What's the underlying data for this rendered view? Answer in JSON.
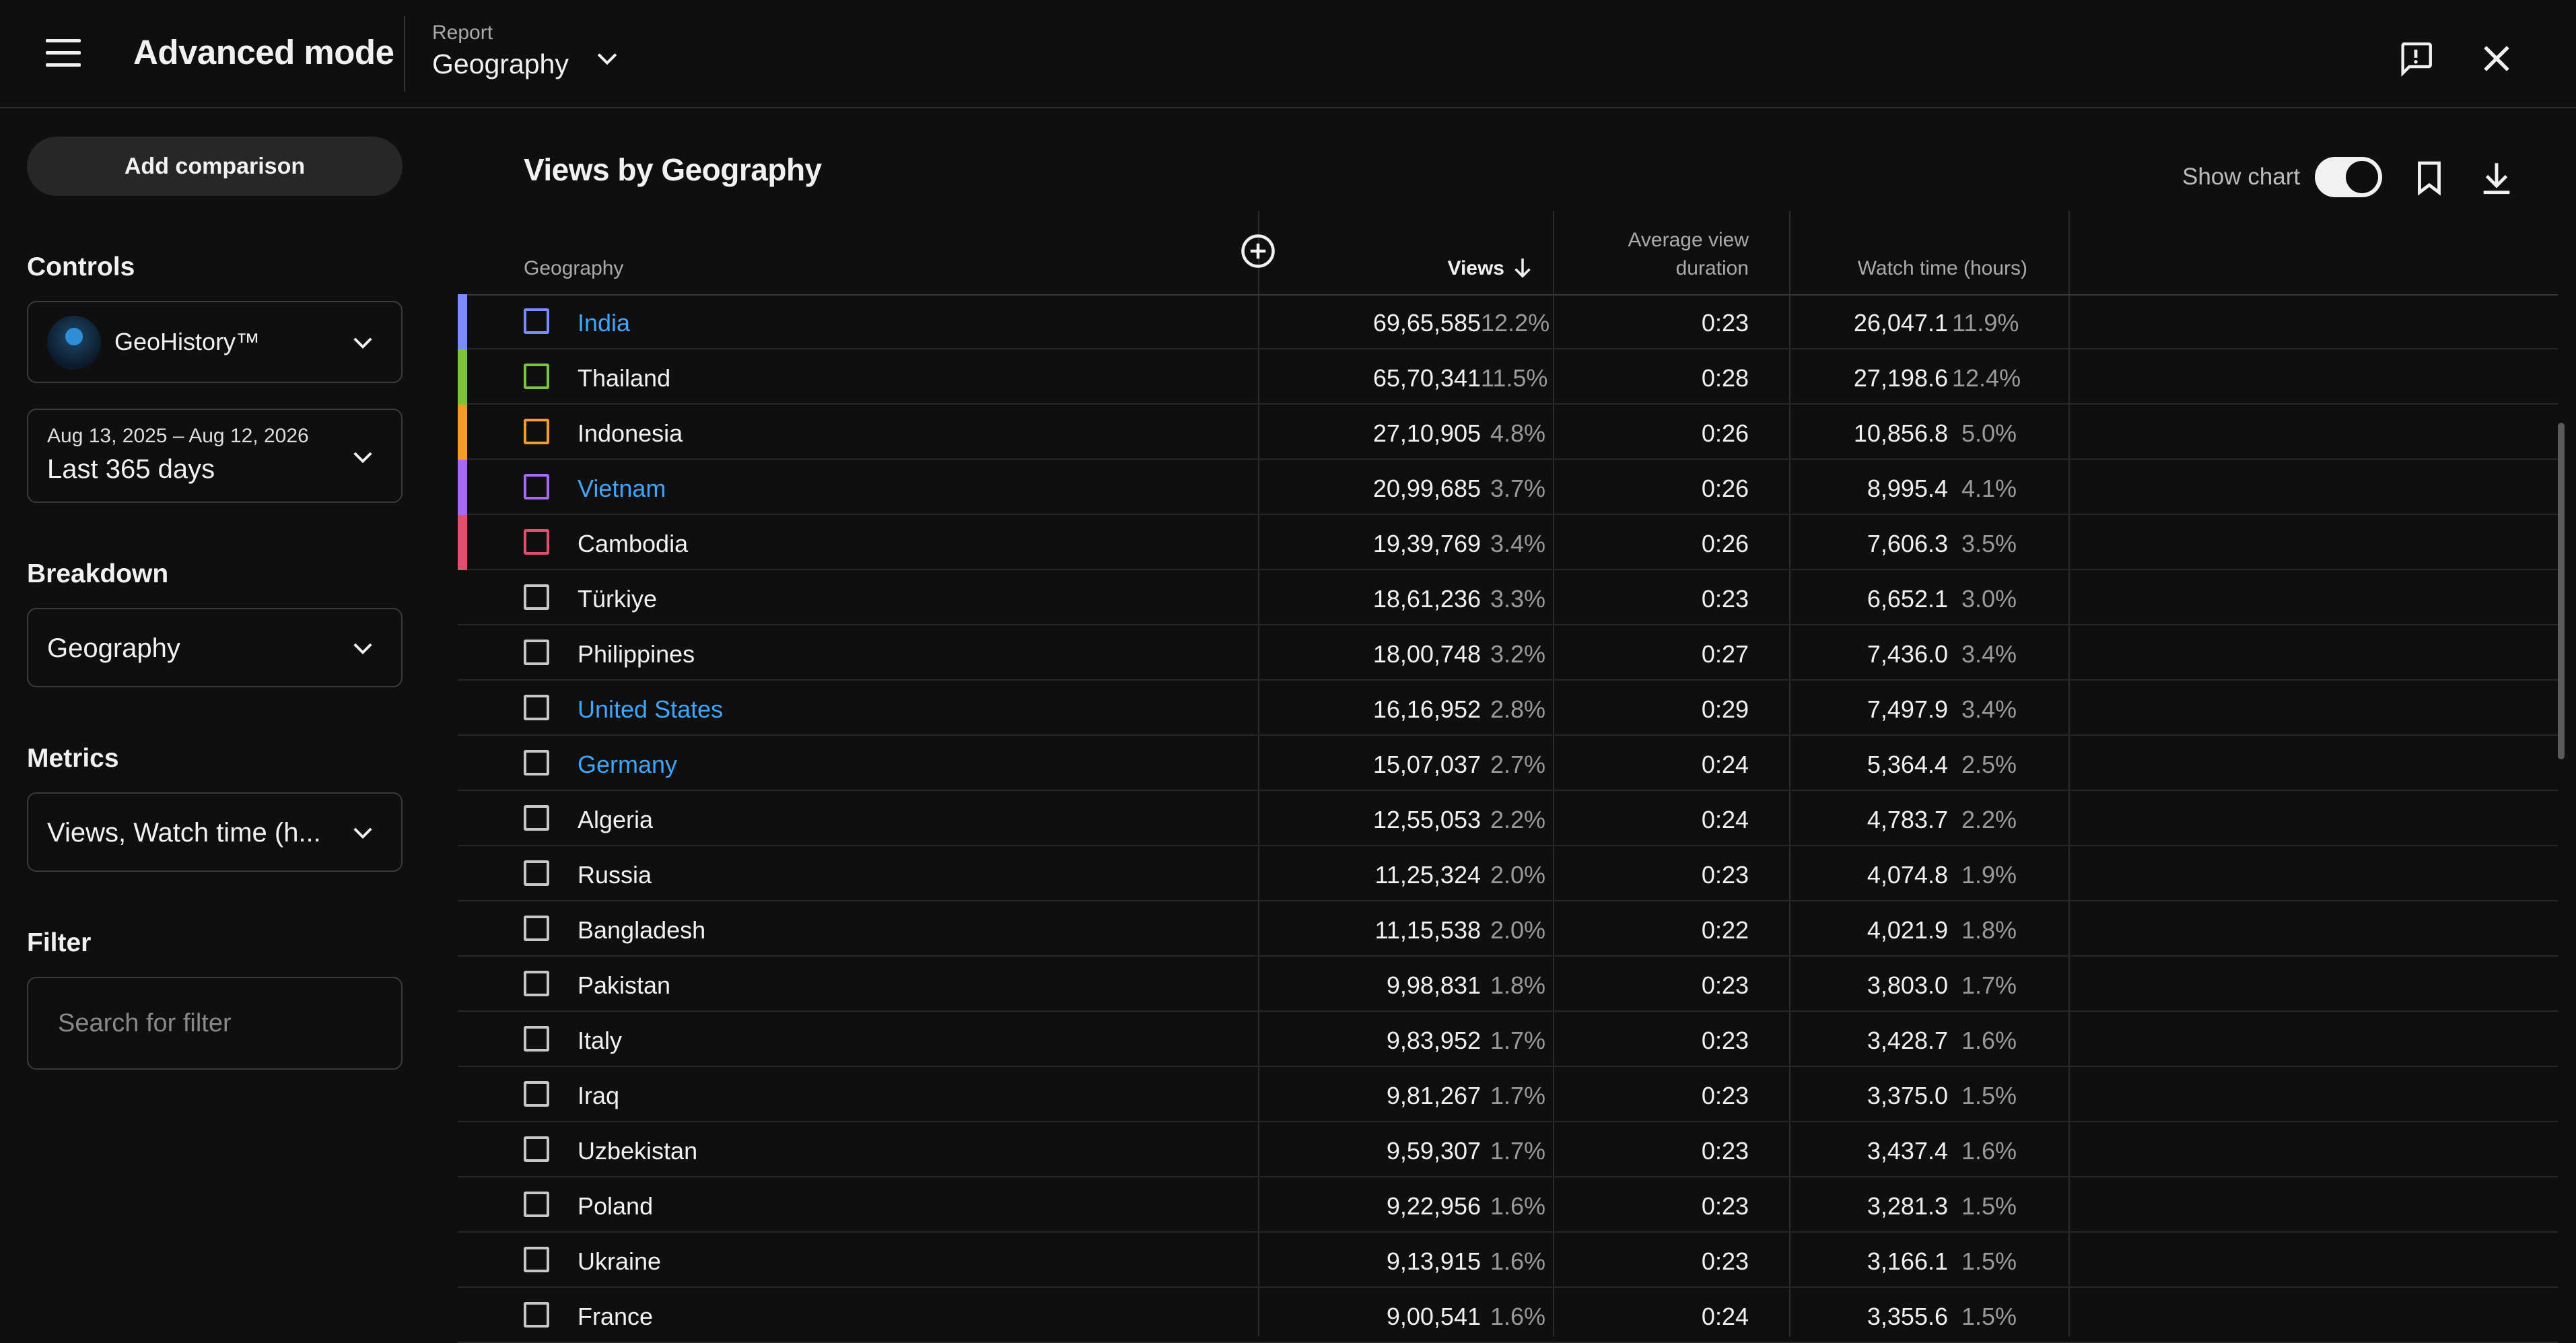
{
  "header": {
    "app_title": "Advanced mode",
    "report_label": "Report",
    "report_value": "Geography"
  },
  "sidebar": {
    "add_comparison": "Add comparison",
    "controls_label": "Controls",
    "channel_name": "GeoHistory™",
    "date_range_small": "Aug 13, 2025 – Aug 12, 2026",
    "date_range": "Last 365 days",
    "breakdown_label": "Breakdown",
    "breakdown_value": "Geography",
    "metrics_label": "Metrics",
    "metrics_value": "Views, Watch time (h...",
    "filter_label": "Filter",
    "filter_placeholder": "Search for filter"
  },
  "main": {
    "title": "Views by Geography",
    "show_chart_label": "Show chart",
    "show_chart_on": true
  },
  "table": {
    "headers": {
      "geography": "Geography",
      "views": "Views",
      "avd_line1": "Average view",
      "avd_line2": "duration",
      "watch_time": "Watch time (hours)"
    },
    "rows": [
      {
        "country": "India",
        "link": true,
        "color": "#7b8cff",
        "views": "69,65,585",
        "views_pct": "12.2%",
        "avd": "0:23",
        "wt": "26,047.1",
        "wt_pct": "11.9%"
      },
      {
        "country": "Thailand",
        "link": false,
        "color": "#7cc43a",
        "views": "65,70,341",
        "views_pct": "11.5%",
        "avd": "0:28",
        "wt": "27,198.6",
        "wt_pct": "12.4%"
      },
      {
        "country": "Indonesia",
        "link": false,
        "color": "#f59b29",
        "views": "27,10,905",
        "views_pct": "4.8%",
        "avd": "0:26",
        "wt": "10,856.8",
        "wt_pct": "5.0%"
      },
      {
        "country": "Vietnam",
        "link": true,
        "color": "#a66bf5",
        "views": "20,99,685",
        "views_pct": "3.7%",
        "avd": "0:26",
        "wt": "8,995.4",
        "wt_pct": "4.1%"
      },
      {
        "country": "Cambodia",
        "link": false,
        "color": "#e0506e",
        "views": "19,39,769",
        "views_pct": "3.4%",
        "avd": "0:26",
        "wt": "7,606.3",
        "wt_pct": "3.5%"
      },
      {
        "country": "Türkiye",
        "link": false,
        "color": "",
        "views": "18,61,236",
        "views_pct": "3.3%",
        "avd": "0:23",
        "wt": "6,652.1",
        "wt_pct": "3.0%"
      },
      {
        "country": "Philippines",
        "link": false,
        "color": "",
        "views": "18,00,748",
        "views_pct": "3.2%",
        "avd": "0:27",
        "wt": "7,436.0",
        "wt_pct": "3.4%"
      },
      {
        "country": "United States",
        "link": true,
        "color": "",
        "views": "16,16,952",
        "views_pct": "2.8%",
        "avd": "0:29",
        "wt": "7,497.9",
        "wt_pct": "3.4%"
      },
      {
        "country": "Germany",
        "link": true,
        "color": "",
        "views": "15,07,037",
        "views_pct": "2.7%",
        "avd": "0:24",
        "wt": "5,364.4",
        "wt_pct": "2.5%"
      },
      {
        "country": "Algeria",
        "link": false,
        "color": "",
        "views": "12,55,053",
        "views_pct": "2.2%",
        "avd": "0:24",
        "wt": "4,783.7",
        "wt_pct": "2.2%"
      },
      {
        "country": "Russia",
        "link": false,
        "color": "",
        "views": "11,25,324",
        "views_pct": "2.0%",
        "avd": "0:23",
        "wt": "4,074.8",
        "wt_pct": "1.9%"
      },
      {
        "country": "Bangladesh",
        "link": false,
        "color": "",
        "views": "11,15,538",
        "views_pct": "2.0%",
        "avd": "0:22",
        "wt": "4,021.9",
        "wt_pct": "1.8%"
      },
      {
        "country": "Pakistan",
        "link": false,
        "color": "",
        "views": "9,98,831",
        "views_pct": "1.8%",
        "avd": "0:23",
        "wt": "3,803.0",
        "wt_pct": "1.7%"
      },
      {
        "country": "Italy",
        "link": false,
        "color": "",
        "views": "9,83,952",
        "views_pct": "1.7%",
        "avd": "0:23",
        "wt": "3,428.7",
        "wt_pct": "1.6%"
      },
      {
        "country": "Iraq",
        "link": false,
        "color": "",
        "views": "9,81,267",
        "views_pct": "1.7%",
        "avd": "0:23",
        "wt": "3,375.0",
        "wt_pct": "1.5%"
      },
      {
        "country": "Uzbekistan",
        "link": false,
        "color": "",
        "views": "9,59,307",
        "views_pct": "1.7%",
        "avd": "0:23",
        "wt": "3,437.4",
        "wt_pct": "1.6%"
      },
      {
        "country": "Poland",
        "link": false,
        "color": "",
        "views": "9,22,956",
        "views_pct": "1.6%",
        "avd": "0:23",
        "wt": "3,281.3",
        "wt_pct": "1.5%"
      },
      {
        "country": "Ukraine",
        "link": false,
        "color": "",
        "views": "9,13,915",
        "views_pct": "1.6%",
        "avd": "0:23",
        "wt": "3,166.1",
        "wt_pct": "1.5%"
      },
      {
        "country": "France",
        "link": false,
        "color": "",
        "views": "9,00,541",
        "views_pct": "1.6%",
        "avd": "0:24",
        "wt": "3,355.6",
        "wt_pct": "1.5%"
      }
    ]
  },
  "icons": {
    "menu": "menu-icon",
    "feedback": "feedback-icon",
    "close": "close-icon",
    "bookmark": "bookmark-icon",
    "download": "download-icon",
    "add_column": "add-circle-icon",
    "sort_down": "arrow-down-icon"
  }
}
